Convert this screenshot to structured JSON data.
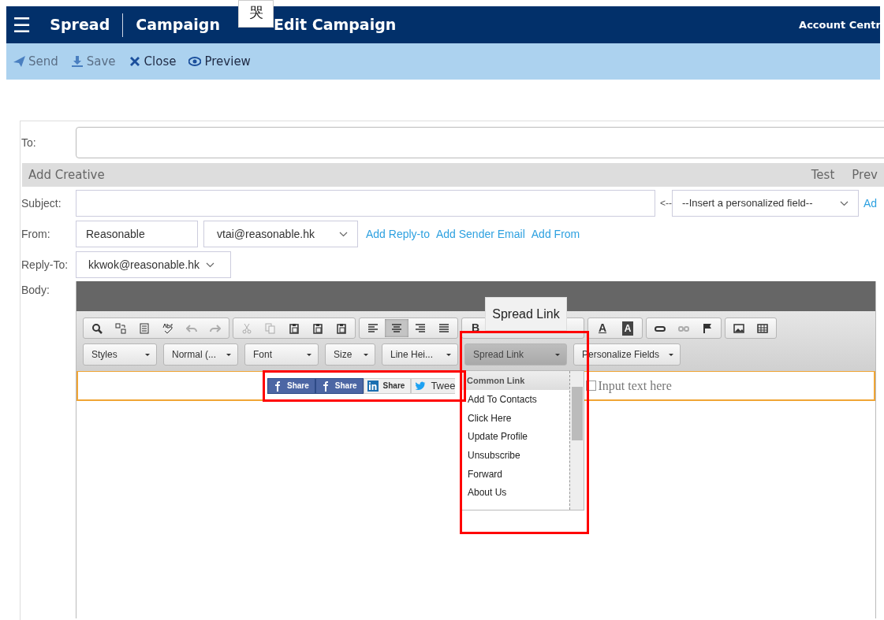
{
  "header": {
    "menu_icon": "☰",
    "title": "Spread",
    "section": "Campaign",
    "page": "Edit Campaign",
    "account": "Account Centr",
    "ime_popup": "哭"
  },
  "actions": [
    {
      "kind": "send",
      "label": "Send",
      "disabled": true
    },
    {
      "kind": "save",
      "label": "Save",
      "disabled": true
    },
    {
      "kind": "close",
      "label": "Close",
      "disabled": false
    },
    {
      "kind": "preview",
      "label": "Preview",
      "disabled": false
    }
  ],
  "form": {
    "to_label": "To:",
    "creative_title": "Add Creative",
    "creative_links": [
      "Test",
      "Prev"
    ],
    "subject_label": "Subject:",
    "insert_arrow": "<--",
    "personalized_field": "--Insert a personalized field--",
    "add_link": "Ad",
    "from_label": "From:",
    "from_name": "Reasonable",
    "from_email": "vtai@reasonable.hk",
    "from_links": [
      "Add Reply-to",
      "Add Sender Email",
      "Add From"
    ],
    "reply_label": "Reply-To:",
    "reply_email": "kkwok@reasonable.hk",
    "body_label": "Body:"
  },
  "editor": {
    "toolbar_groups": [
      [
        {
          "kind": "search",
          "selected": false,
          "disabled": false
        },
        {
          "kind": "replace",
          "selected": false,
          "disabled": false
        },
        {
          "kind": "select-all",
          "selected": false,
          "disabled": false
        },
        {
          "kind": "spellcheck",
          "selected": false,
          "disabled": false
        },
        {
          "kind": "undo",
          "selected": false,
          "disabled": true
        },
        {
          "kind": "redo",
          "selected": false,
          "disabled": true
        }
      ],
      [
        {
          "kind": "cut",
          "selected": false,
          "disabled": true
        },
        {
          "kind": "copy",
          "selected": false,
          "disabled": true
        },
        {
          "kind": "paste",
          "selected": false,
          "disabled": false
        },
        {
          "kind": "paste",
          "selected": false,
          "disabled": false
        },
        {
          "kind": "paste",
          "selected": false,
          "disabled": false
        }
      ],
      [
        {
          "kind": "align-left",
          "selected": false,
          "disabled": false
        },
        {
          "kind": "align-center",
          "selected": true,
          "disabled": false
        },
        {
          "kind": "align-right",
          "selected": false,
          "disabled": false
        },
        {
          "kind": "justify",
          "selected": false,
          "disabled": false
        }
      ],
      [
        {
          "kind": "letter",
          "label": "B",
          "selected": false,
          "disabled": false
        },
        {
          "kind": "covered"
        },
        {
          "kind": "covered"
        },
        {
          "kind": "covered"
        },
        {
          "kind": "covered"
        }
      ],
      [
        {
          "kind": "text-color",
          "label": "A",
          "selected": false,
          "disabled": false
        },
        {
          "kind": "bg-color",
          "label": "A",
          "selected": false,
          "disabled": false
        }
      ],
      [
        {
          "kind": "link",
          "selected": false,
          "disabled": false
        },
        {
          "kind": "unlink",
          "selected": false,
          "disabled": true
        },
        {
          "kind": "flag",
          "selected": false,
          "disabled": false
        }
      ],
      [
        {
          "kind": "image",
          "selected": false,
          "disabled": false
        },
        {
          "kind": "table",
          "selected": false,
          "disabled": false
        }
      ]
    ],
    "tooltip": "Spread Link",
    "dropdowns": [
      {
        "label": "Styles",
        "open": false
      },
      {
        "label": "Normal (...",
        "open": false
      },
      {
        "label": "Font",
        "open": false
      },
      {
        "label": "Size",
        "open": false
      },
      {
        "label": "Line Hei...",
        "open": false
      },
      {
        "label": "Spread Link",
        "open": true
      },
      {
        "label": "Personalize Fields",
        "open": false
      }
    ],
    "menu": {
      "header": "Common Link",
      "items": [
        "Add To Contacts",
        "Click Here",
        "Update Profile",
        "Unsubscribe",
        "Forward",
        "About Us"
      ]
    },
    "share_buttons": [
      {
        "kind": "facebook",
        "label": "Share"
      },
      {
        "kind": "facebook",
        "label": "Share"
      },
      {
        "kind": "linkedin",
        "label": "Share"
      },
      {
        "kind": "twitter",
        "label": "Twee"
      }
    ],
    "input_text": "Input text here"
  }
}
